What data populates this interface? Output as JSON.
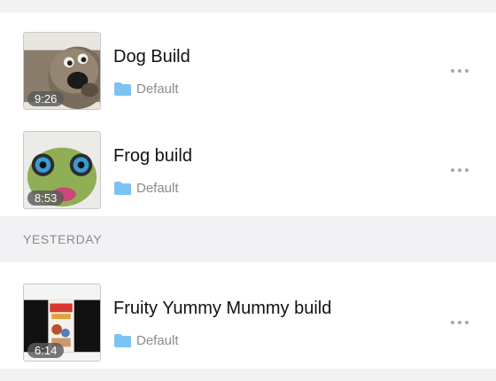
{
  "section_today": {
    "videos": [
      {
        "title": "Dog Build",
        "duration": "9:26",
        "folder": "Default"
      },
      {
        "title": "Frog build",
        "duration": "8:53",
        "folder": "Default"
      }
    ]
  },
  "section_yesterday": {
    "header": "YESTERDAY",
    "videos": [
      {
        "title": "Fruity Yummy Mummy build",
        "duration": "6:14",
        "folder": "Default"
      }
    ]
  },
  "icons": {
    "folder": "folder-icon",
    "more": "ellipsis-icon"
  },
  "colors": {
    "folder": "#7cc3f3",
    "background": "#f2f2f4"
  }
}
